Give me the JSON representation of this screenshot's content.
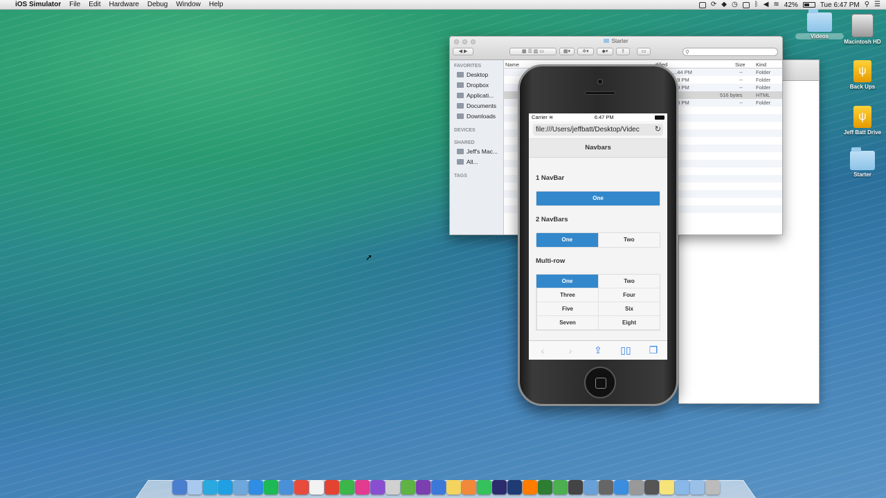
{
  "menubar": {
    "app_name": "iOS Simulator",
    "items": [
      "File",
      "Edit",
      "Hardware",
      "Debug",
      "Window",
      "Help"
    ],
    "battery_pct": "42%",
    "clock": "Tue 6:47 PM"
  },
  "desktop_icons": [
    {
      "label": "Videos",
      "icon": "folder-icon"
    },
    {
      "label": "Macintosh HD",
      "icon": "hard-drive-icon"
    },
    {
      "label": "Back Ups",
      "icon": "usb-drive-icon"
    },
    {
      "label": "Jeff Batt Drive",
      "icon": "usb-drive-icon"
    },
    {
      "label": "Starter",
      "icon": "folder-icon"
    }
  ],
  "finder": {
    "title": "Starter",
    "sidebar": {
      "favorites_header": "FAVORITES",
      "favorites": [
        "Desktop",
        "Dropbox",
        "Applicati...",
        "Documents",
        "Downloads"
      ],
      "devices_header": "DEVICES",
      "shared_header": "SHARED",
      "shared": [
        "Jeff's Mac...",
        "All..."
      ],
      "tags_header": "TAGS"
    },
    "columns": {
      "name": "Name",
      "modified": "...dified",
      "size": "Size",
      "kind": "Kind"
    },
    "rows": [
      {
        "modified": "...44 PM",
        "size": "--",
        "kind": "Folder"
      },
      {
        "modified": "...9 PM",
        "size": "--",
        "kind": "Folder"
      },
      {
        "modified": "...9 PM",
        "size": "--",
        "kind": "Folder"
      },
      {
        "modified": "",
        "size": "516 bytes",
        "kind": "HTML"
      },
      {
        "modified": "...8 PM",
        "size": "--",
        "kind": "Folder"
      }
    ]
  },
  "phone": {
    "carrier": "Carrier",
    "time": "6:47 PM",
    "url": "file:///Users/jeffbatt/Desktop/Videc",
    "page_title": "Navbars",
    "sections": [
      {
        "heading": "1 NavBar",
        "buttons": [
          "One"
        ]
      },
      {
        "heading": "2 NavBars",
        "buttons": [
          "One",
          "Two"
        ]
      },
      {
        "heading": "Multi-row",
        "buttons": [
          "One",
          "Two",
          "Three",
          "Four",
          "Five",
          "Six",
          "Seven",
          "Eight"
        ]
      }
    ]
  },
  "dock": {
    "apps": [
      "Finder",
      "Launchpad",
      "Twitter",
      "Skype",
      "Maps",
      "App Store",
      "Spotify",
      "Safari",
      "Chrome",
      "Calendar",
      "Todoist",
      "Numbers",
      "iTunes",
      "OmniFocus",
      "Ftp",
      "Evernote",
      "OneNote",
      "Things",
      "Notes",
      "Photos",
      "Dreamweaver",
      "Animate",
      "Photoshop",
      "Illustrator",
      "Captivate",
      "Camtasia",
      "Screenflow",
      "Preview",
      "Instruments",
      "Xcode",
      "Calculator",
      "Activity",
      "Stickies",
      "Folder",
      "Downloads",
      "Trash"
    ]
  },
  "colors": {
    "jqm_active": "#3388cc",
    "ios_blue": "#2f7fe4"
  }
}
